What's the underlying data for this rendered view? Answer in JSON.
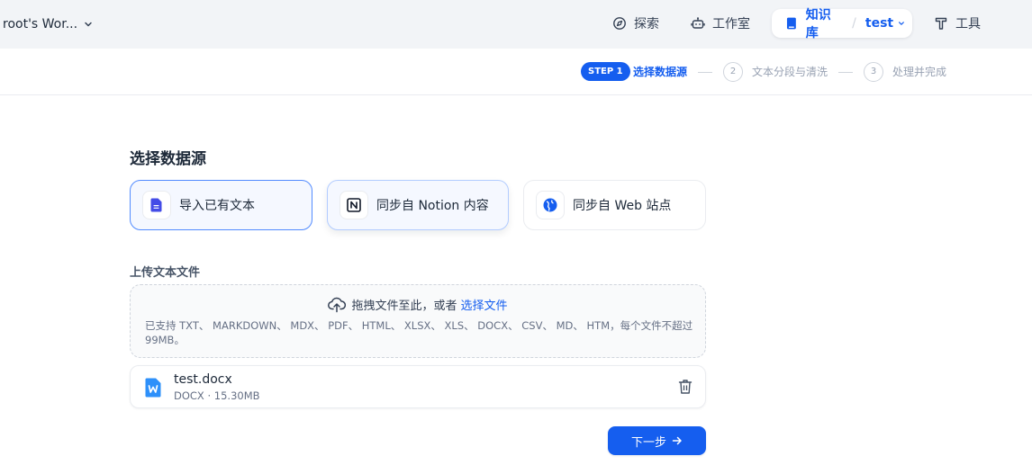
{
  "header": {
    "workspace_name": "root's Wor...",
    "nav": {
      "explore": "探索",
      "studio": "工作室",
      "knowledge": "知识库",
      "knowledge_separator": "/",
      "dataset_name": "test",
      "tools": "工具"
    }
  },
  "steps": {
    "step1_badge": "STEP 1",
    "step1_label": "选择数据源",
    "step2_num": "2",
    "step2_label": "文本分段与清洗",
    "step3_num": "3",
    "step3_label": "处理并完成"
  },
  "main": {
    "title": "选择数据源",
    "sources": {
      "file": "导入已有文本",
      "notion": "同步自 Notion 内容",
      "web": "同步自 Web 站点"
    },
    "upload_title": "上传文本文件",
    "dropzone": {
      "text": "拖拽文件至此，或者",
      "link": "选择文件",
      "hint": "已支持 TXT、 MARKDOWN、 MDX、 PDF、 HTML、 XLSX、 XLS、 DOCX、 CSV、 MD、 HTM，每个文件不超过 99MB。"
    },
    "file": {
      "name": "test.docx",
      "meta": "DOCX · 15.30MB"
    },
    "next_button": "下一步"
  },
  "colors": {
    "primary": "#155eef",
    "header_bg": "#f2f4f7"
  }
}
